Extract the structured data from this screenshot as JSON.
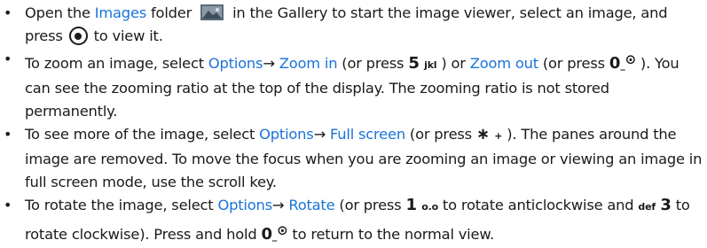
{
  "bullet_char": "•",
  "keys": {
    "five": "5",
    "jkl": "jkl",
    "zero": "0",
    "underscore": "_",
    "star": "∗",
    "plus": "+",
    "one": "1",
    "oo": "o.o",
    "def": "def",
    "three": "3",
    "web_glyph": "⊙"
  },
  "icons": {
    "folder": "images-folder-icon",
    "nav_key": "navi-key-select-icon",
    "web": "web-key-icon"
  },
  "items": [
    {
      "t1": "Open the ",
      "k1": "Images",
      "t2": " folder",
      "t3": " in the Gallery to start the image viewer, select an image, and press ",
      "t4": " to view it."
    },
    {
      "t1": "To zoom an image, select ",
      "k1": "Options",
      "arrow": "→",
      "k2": "Zoom in",
      "t2": " (or press ",
      "t3": " ) or ",
      "k3": "Zoom out",
      "t4": " (or press ",
      "t5": " ). You can see the zooming ratio at the top of the display. The zooming ratio is not stored permanently."
    },
    {
      "t1": "To see more of the image, select ",
      "k1": "Options",
      "arrow": "→",
      "k2": "Full screen",
      "t2": " (or press ",
      "t3": " ). The panes around the image are removed. To move the focus when you are zooming an image or viewing an image in full screen mode, use the scroll key."
    },
    {
      "t1": "To rotate the image, select ",
      "k1": "Options",
      "arrow": "→",
      "k2": "Rotate",
      "t2": " (or press ",
      "t3": " to rotate anticlockwise and ",
      "t4": " to rotate clockwise). Press and hold ",
      "t5": " to return to the normal view."
    }
  ],
  "colors": {
    "keyword": "#1a73d8",
    "text": "#1a1a1a"
  }
}
